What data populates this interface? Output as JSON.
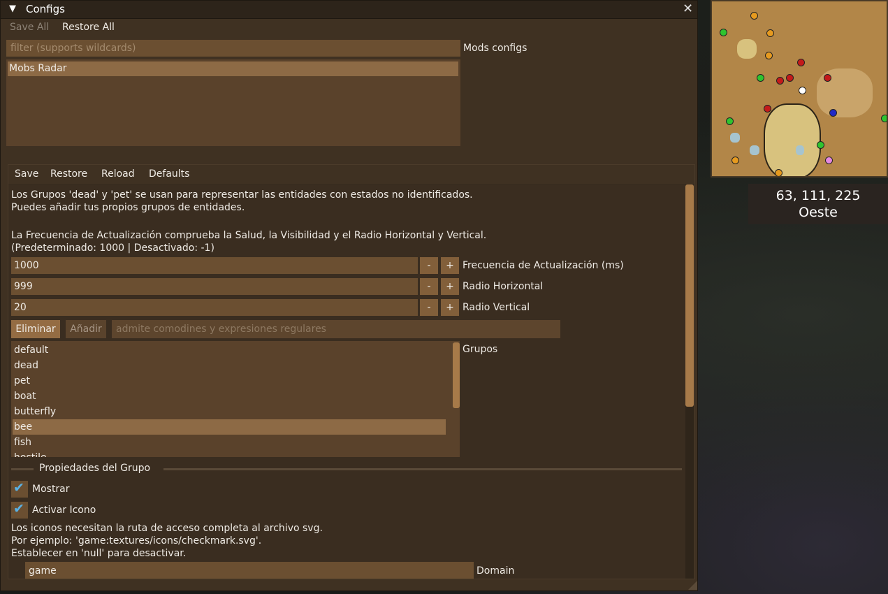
{
  "window": {
    "title": "Configs",
    "save_all": "Save All",
    "restore_all": "Restore All"
  },
  "mods": {
    "filter_placeholder": "filter (supports wildcards)",
    "filter_label": "Mods configs",
    "items": [
      "Mobs Radar"
    ]
  },
  "config": {
    "toolbar": {
      "save": "Save",
      "restore": "Restore",
      "reload": "Reload",
      "defaults": "Defaults"
    },
    "description": [
      "Los Grupos 'dead' y 'pet' se usan para representar las entidades con estados no identificados.",
      "Puedes añadir tus propios grupos de entidades.",
      "La Frecuencia de Actualización comprueba la Salud, la Visibilidad y el Radio Horizontal y Vertical.",
      "(Predeterminado: 1000 | Desactivado: -1)"
    ],
    "fields": [
      {
        "value": "1000",
        "label": "Frecuencia de Actualización (ms)"
      },
      {
        "value": "999",
        "label": "Radio Horizontal"
      },
      {
        "value": "20",
        "label": "Radio Vertical"
      }
    ],
    "stepper": {
      "minus": "-",
      "plus": "+"
    },
    "remove_button": "Eliminar",
    "add_button": "Añadir",
    "pattern_placeholder": "admite comodines y expresiones regulares",
    "groups_label": "Grupos",
    "groups": [
      "default",
      "dead",
      "pet",
      "boat",
      "butterfly",
      "bee",
      "fish",
      "hostile"
    ],
    "selected_group": "bee",
    "group_props_title": "Propiedades del Grupo",
    "show_label": "Mostrar",
    "icon_label": "Activar Icono",
    "show_checked": true,
    "icon_checked": true,
    "icon_help": [
      "Los iconos necesitan la ruta de acceso completa al archivo svg.",
      "Por ejemplo: 'game:textures/icons/checkmark.svg'.",
      "Establecer en 'null' para desactivar."
    ],
    "domain_value": "game",
    "domain_label": "Domain"
  },
  "minimap": {
    "coordinates": "63, 111, 225",
    "direction": "Oeste",
    "colors": {
      "terrain": "#b28648",
      "water": "#d8c27e",
      "hostile": "#c41a1a",
      "passive": "#2fc42f",
      "neutral": "#e69a1f",
      "player": "#ffffff"
    }
  }
}
